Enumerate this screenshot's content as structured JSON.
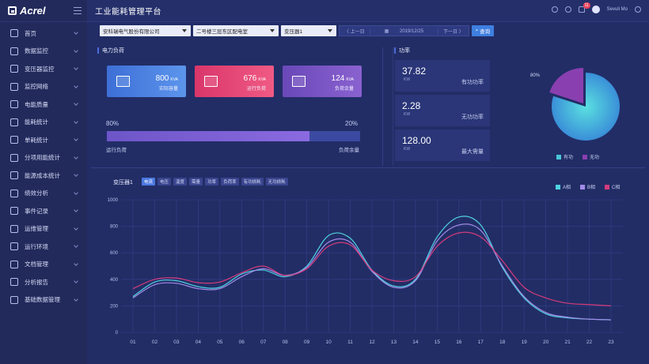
{
  "sidebar": {
    "logo": "Acrel",
    "items": [
      {
        "label": "首页",
        "icon": "monitor-icon"
      },
      {
        "label": "数据监控",
        "icon": "chart-screen-icon"
      },
      {
        "label": "变压器监控",
        "icon": "transformer-icon"
      },
      {
        "label": "监控网络",
        "icon": "network-icon"
      },
      {
        "label": "电能质量",
        "icon": "shield-icon"
      },
      {
        "label": "能耗统计",
        "icon": "bar-chart-icon"
      },
      {
        "label": "单耗统计",
        "icon": "gauge-icon"
      },
      {
        "label": "分项用能统计",
        "icon": "pin-icon"
      },
      {
        "label": "能源成本统计",
        "icon": "yen-icon"
      },
      {
        "label": "绩效分析",
        "icon": "trend-icon"
      },
      {
        "label": "事件记录",
        "icon": "clock-icon"
      },
      {
        "label": "运维管理",
        "icon": "tools-icon"
      },
      {
        "label": "运行环境",
        "icon": "environment-icon"
      },
      {
        "label": "文档管理",
        "icon": "document-icon"
      },
      {
        "label": "分析报告",
        "icon": "report-icon"
      },
      {
        "label": "基础数据管理",
        "icon": "globe-icon"
      }
    ]
  },
  "header": {
    "title": "工业能耗管理平台",
    "notification_count": "11",
    "user": "Sevuli Mo"
  },
  "filters": {
    "company": "安科瑞电气股份有限公司",
    "location": "二号楼三层东区配电室",
    "transformer": "变压器1",
    "prev_label": "〈 上一日",
    "date": "2019/12/25",
    "next_label": "下一日 〉",
    "query_label": "查询"
  },
  "load_panel": {
    "title": "电力负荷",
    "cards": [
      {
        "value": "800",
        "unit": "KVA",
        "label": "实际容量",
        "color": "#4a7fe0"
      },
      {
        "value": "676",
        "unit": "KVA",
        "label": "运行负荷",
        "color": "#e4456e"
      },
      {
        "value": "124",
        "unit": "KVA",
        "label": "负荷余量",
        "color": "#7a55c4"
      }
    ],
    "running_pct_text": "80%",
    "remaining_pct_text": "20%",
    "running_fraction": 0.8,
    "running_label": "运行负荷",
    "remaining_label": "负荷余量"
  },
  "power_panel": {
    "title": "功率",
    "cards": [
      {
        "value": "37.82",
        "unit": "KW",
        "label": "有功功率"
      },
      {
        "value": "2.28",
        "unit": "KW",
        "label": "无功功率"
      },
      {
        "value": "128.00",
        "unit": "KW",
        "label": "最大需量"
      }
    ],
    "pie": {
      "slices": [
        {
          "name": "有功",
          "value": 80,
          "label": "80%",
          "color": "#49c6d8"
        },
        {
          "name": "无功",
          "value": 20,
          "label": "20%",
          "color": "#8a3fb0"
        }
      ]
    }
  },
  "trend_panel": {
    "title": "变压器1",
    "tabs": [
      "电流",
      "电压",
      "温度",
      "需量",
      "功率",
      "负荷率",
      "有功损耗",
      "无功损耗"
    ],
    "active_tab": 0
  },
  "chart_data": {
    "type": "line",
    "title": "",
    "xlabel": "",
    "ylabel": "",
    "x": [
      "01",
      "02",
      "03",
      "04",
      "05",
      "06",
      "07",
      "08",
      "09",
      "10",
      "11",
      "12",
      "13",
      "14",
      "15",
      "16",
      "17",
      "18",
      "19",
      "20",
      "21",
      "22",
      "23"
    ],
    "ylim": [
      0,
      1000
    ],
    "yticks": [
      0,
      200,
      400,
      600,
      800,
      1000
    ],
    "grid": true,
    "legend": "top-right",
    "series": [
      {
        "name": "A相",
        "color": "#4fd3e0",
        "values": [
          270,
          380,
          390,
          345,
          340,
          440,
          470,
          420,
          500,
          730,
          710,
          470,
          350,
          400,
          720,
          870,
          810,
          490,
          260,
          140,
          110,
          100,
          95
        ]
      },
      {
        "name": "B相",
        "color": "#a48be8",
        "values": [
          260,
          360,
          370,
          330,
          330,
          420,
          480,
          430,
          490,
          680,
          680,
          460,
          340,
          390,
          690,
          810,
          770,
          500,
          270,
          150,
          115,
          100,
          95
        ]
      },
      {
        "name": "C相",
        "color": "#d63b7a",
        "values": [
          330,
          400,
          410,
          375,
          380,
          450,
          500,
          430,
          480,
          650,
          660,
          470,
          390,
          420,
          650,
          750,
          720,
          540,
          340,
          260,
          220,
          210,
          200
        ]
      }
    ]
  }
}
